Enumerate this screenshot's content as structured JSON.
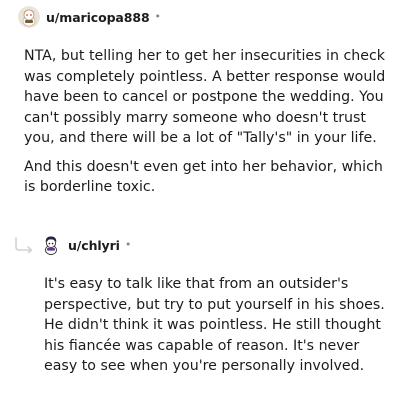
{
  "comments": [
    {
      "username": "u/maricopa888",
      "separator": "•",
      "paragraphs": [
        "NTA, but telling her to get her insecurities in check was completely pointless. A better response would have been to cancel or postpone the wedding. You can't possibly marry someone who doesn't trust you, and there will be a lot of \"Tally's\" in your life.",
        "And this doesn't even get into her behavior, which is borderline toxic."
      ]
    },
    {
      "username": "u/chlyri",
      "separator": "•",
      "paragraphs": [
        "It's easy to talk like that from an outsider's perspective, but try to put yourself in his shoes. He didn't think it was pointless. He still thought his fiancée was capable of reason. It's never easy to see when you're personally involved."
      ]
    }
  ],
  "colors": {
    "text": "#1c1c1c",
    "meta": "#878a8c",
    "reply_line": "#cfd3d6"
  },
  "icons": {
    "avatar_1": "snoo-avatar-icon",
    "avatar_2": "snoo-avatar-icon",
    "reply": "reply-arrow-icon"
  }
}
